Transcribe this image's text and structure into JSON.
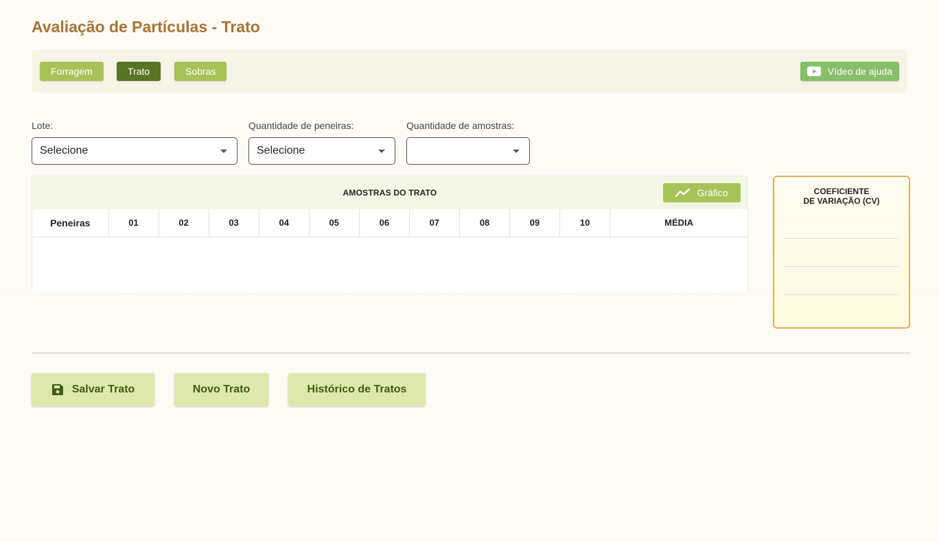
{
  "page": {
    "title": "Avaliação de Partículas - Trato"
  },
  "tabs": [
    {
      "label": "Forragem",
      "active": false
    },
    {
      "label": "Trato",
      "active": true
    },
    {
      "label": "Sobras",
      "active": false
    }
  ],
  "help": {
    "label": "Vídeo de ajuda",
    "icon": "youtube-play-icon"
  },
  "filters": {
    "lote": {
      "label": "Lote:",
      "value": "Selecione"
    },
    "peneiras": {
      "label": "Quantidade de peneiras:",
      "value": "Selecione"
    },
    "amostras": {
      "label": "Quantidade de amostras:",
      "value": ""
    }
  },
  "samples": {
    "title": "AMOSTRAS DO TRATO",
    "chart_button": {
      "label": "Gráfico",
      "icon": "line-chart-icon"
    },
    "columns": [
      "Peneiras",
      "01",
      "02",
      "03",
      "04",
      "05",
      "06",
      "07",
      "08",
      "09",
      "10",
      "MÉDIA"
    ]
  },
  "cv": {
    "title_line1": "COEFICIENTE",
    "title_line2": "DE VARIAÇÃO (CV)"
  },
  "actions": {
    "save": {
      "label": "Salvar Trato",
      "icon": "floppy-disk-icon"
    },
    "new": {
      "label": "Novo Trato"
    },
    "history": {
      "label": "Histórico de Tratos"
    }
  },
  "colors": {
    "title": "#a87436",
    "tab": "#a8c25a",
    "tab_active": "#5a7426",
    "help": "#86c06a",
    "action_bg": "#dfe8ac",
    "action_text": "#3e5e12",
    "cv_border": "#d9b25d"
  }
}
